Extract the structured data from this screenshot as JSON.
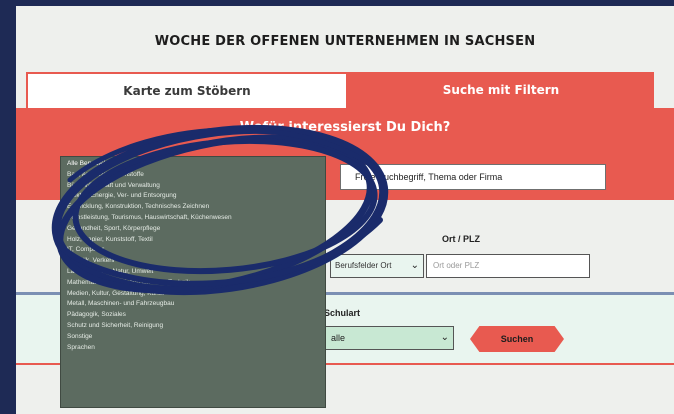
{
  "page_title": "WOCHE DER OFFENEN UNTERNEHMEN IN SACHSEN",
  "tabs": {
    "browse_label": "Karte zum Stöbern",
    "filter_label": "Suche mit Filtern"
  },
  "search_band": {
    "question": "Wofür interessierst Du Dich?",
    "search_value": "Freie Suchbegriff, Thema oder Firma"
  },
  "filters": {
    "category_value": "Berufsfelder Ort",
    "ort_label": "Ort / PLZ",
    "ort_placeholder": "Ort oder PLZ",
    "schulart_label": "Schulart",
    "schulart_value": "alle",
    "search_button": "Suchen"
  },
  "dropdown_options": [
    "Alle Berufsfelder",
    "Bau, Architektur, Rohstoffe",
    "Büro, Wirtschaft und Verwaltung",
    "Elektro, Energie, Ver- und Entsorgung",
    "Entwicklung, Konstruktion, Technisches Zeichnen",
    "Dienstleistung, Tourismus, Hauswirtschaft, Küchenwesen",
    "Gesundheit, Sport, Körperpflege",
    "Holz, Papier, Kunststoff, Textil",
    "IT, Computer",
    "Logistik, Verkehr",
    "Landwirtschaft, Natur, Umwelt",
    "Mathematik, Naturwissenschaften, Technik",
    "Medien, Kultur, Gestaltung, Kunst",
    "Metall, Maschinen- und Fahrzeugbau",
    "Pädagogik, Soziales",
    "Schutz und Sicherheit, Reinigung",
    "Sonstige",
    "Sprachen"
  ],
  "colors": {
    "accent": "#e85a50",
    "frame": "#1e2a55",
    "scribble": "#1a2b6b"
  }
}
